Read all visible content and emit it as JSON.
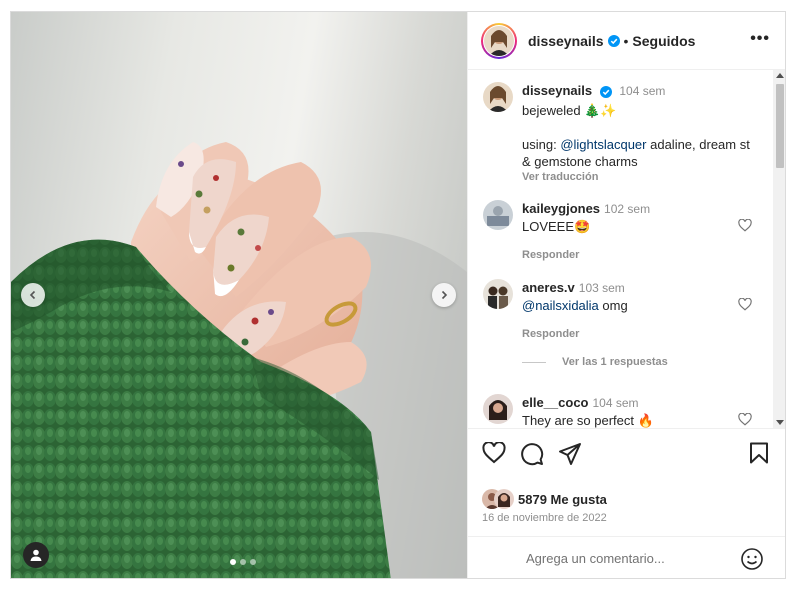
{
  "post": {
    "username": "disseynails",
    "separator": "•",
    "follow_status": "Seguidos",
    "more": "•••"
  },
  "caption": {
    "username": "disseynails",
    "time": "104 sem",
    "line1": "bejeweled 🎄✨",
    "line2_prefix": "using: ",
    "mention": "@lightslacquer",
    "line2_rest": " adaline, dream st",
    "line3": "& gemstone charms",
    "translate": "Ver traducción"
  },
  "comments": [
    {
      "username": "kaileygjones",
      "time": "102 sem",
      "text": "LOVEEE🤩",
      "reply": "Responder"
    },
    {
      "username": "aneres.v",
      "time": "103 sem",
      "mention": "@nailsxidalia",
      "text": " omg",
      "reply": "Responder"
    },
    {
      "username": "elle__coco",
      "time": "104 sem",
      "text": "They are so perfect 🔥"
    }
  ],
  "view_replies": "Ver las 1 respuestas",
  "likes": "5879 Me gusta",
  "date": "16 de noviembre de 2022",
  "add_comment_placeholder": "Agrega un comentario...",
  "carousel": {
    "count": 3,
    "active_index": 0
  },
  "icons": [
    "verified-badge-icon",
    "more-options-icon",
    "heart-icon",
    "comment-icon",
    "share-icon",
    "save-icon",
    "emoji-icon",
    "tagged-user-icon",
    "chevron-left-icon",
    "chevron-right-icon"
  ],
  "colors": {
    "verified": "#0095f6",
    "sweater": "#2f6b38",
    "link": "#00376b",
    "muted": "#8e8e8e"
  }
}
